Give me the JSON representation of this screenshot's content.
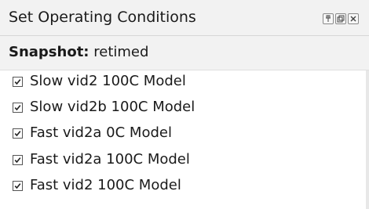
{
  "window": {
    "title": "Set Operating Conditions",
    "buttons": [
      "pin-icon",
      "restore-icon",
      "close-icon"
    ]
  },
  "snapshot": {
    "label": "Snapshot:",
    "value": "retimed"
  },
  "conditions": [
    {
      "label": "Slow vid2 100C Model",
      "checked": true
    },
    {
      "label": "Slow vid2b 100C Model",
      "checked": true
    },
    {
      "label": "Fast vid2a 0C Model",
      "checked": true
    },
    {
      "label": "Fast vid2a 100C Model",
      "checked": true
    },
    {
      "label": "Fast vid2 100C Model",
      "checked": true
    }
  ],
  "colors": {
    "header_bg": "#f2f2f2",
    "text": "#1a1a1a",
    "checkbox_border": "#555555"
  }
}
